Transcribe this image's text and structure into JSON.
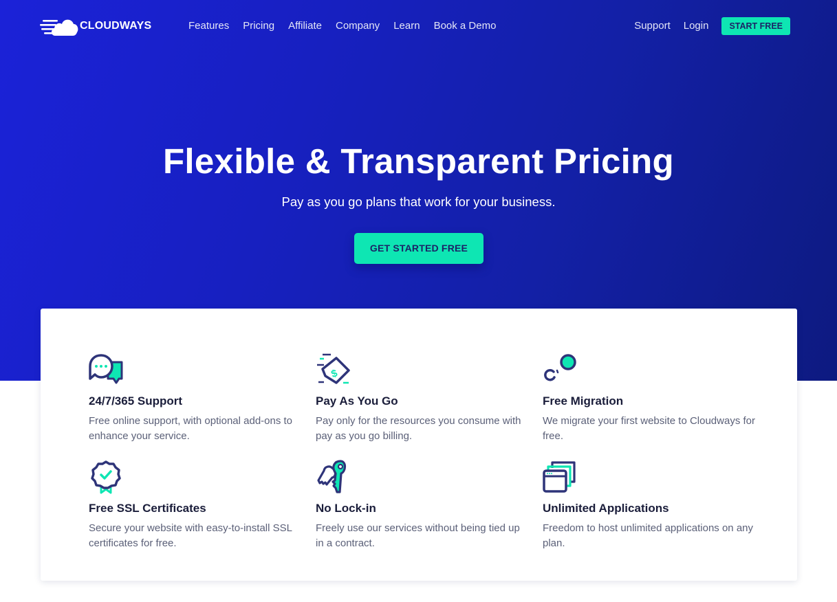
{
  "header": {
    "logo_text": "CLOUDWAYS",
    "nav": [
      "Features",
      "Pricing",
      "Affiliate",
      "Company",
      "Learn",
      "Book a Demo"
    ],
    "support_label": "Support",
    "login_label": "Login",
    "start_free_label": "START FREE"
  },
  "hero": {
    "title": "Flexible & Transparent Pricing",
    "subtitle": "Pay as you go plans that work for your business.",
    "cta_label": "GET STARTED FREE"
  },
  "colors": {
    "accent": "#0ee6b3",
    "navy": "#2e3479",
    "hero_start": "#1b22d8",
    "hero_end": "#0d1a80"
  },
  "features": [
    {
      "icon": "chat-bubbles-icon",
      "title": "24/7/365 Support",
      "description": "Free online support, with optional add-ons to enhance your service."
    },
    {
      "icon": "dollar-tag-icon",
      "title": "Pay As You Go",
      "description": "Pay only for the resources you consume with pay as you go billing."
    },
    {
      "icon": "migration-icon",
      "title": "Free Migration",
      "description": "We migrate your first website to Cloudways for free."
    },
    {
      "icon": "ssl-badge-icon",
      "title": "Free SSL Certificates",
      "description": "Secure your website with easy-to-install SSL certificates for free."
    },
    {
      "icon": "keys-icon",
      "title": "No Lock-in",
      "description": "Freely use our services without being tied up in a contract."
    },
    {
      "icon": "stacked-windows-icon",
      "title": "Unlimited Applications",
      "description": "Freedom to host unlimited applications on any plan."
    }
  ]
}
